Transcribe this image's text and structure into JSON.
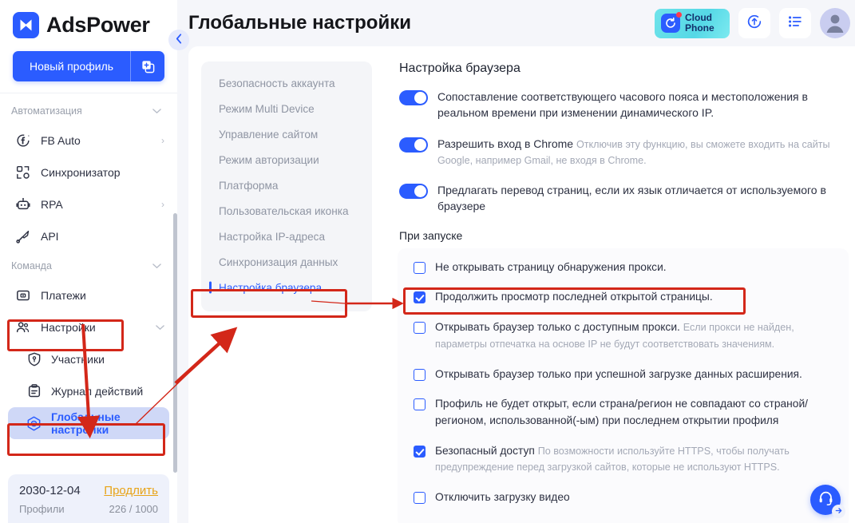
{
  "brand": {
    "name": "AdsPower",
    "logo_icon": "adspower-logo-icon"
  },
  "sidebar": {
    "new_profile_label": "Новый профиль",
    "new_profile_plus_icon": "add-profile-icon",
    "collapse_icon": "chevron-left-icon",
    "groups": [
      {
        "title": "Автоматизация",
        "collapse_icon": "chevron-down-icon",
        "items": [
          {
            "label": "FB Auto",
            "icon": "facebook-auto-icon",
            "chevron": "›"
          },
          {
            "label": "Синхронизатор",
            "icon": "synchronizer-icon",
            "chevron": ""
          },
          {
            "label": "RPA",
            "icon": "robot-icon",
            "chevron": "›"
          },
          {
            "label": "API",
            "icon": "api-icon",
            "chevron": ""
          }
        ]
      },
      {
        "title": "Команда",
        "collapse_icon": "chevron-down-icon",
        "items": [
          {
            "label": "Платежи",
            "icon": "payments-icon",
            "chevron": ""
          },
          {
            "label": "Настройки",
            "icon": "team-icon",
            "chevron": "⌄"
          }
        ],
        "sub_items": [
          {
            "label": "Участники",
            "icon": "shield-user-icon",
            "active": false
          },
          {
            "label": "Журнал действий",
            "icon": "clipboard-icon",
            "active": false
          },
          {
            "label": "Глобальные настройки",
            "icon": "gear-hex-icon",
            "active": true
          }
        ]
      }
    ],
    "footer": {
      "expire_date": "2030-12-04",
      "renew_label": "Продлить",
      "profiles_label": "Профили",
      "profiles_count": "226 / 1000"
    }
  },
  "topbar": {
    "title": "Глобальные настройки",
    "cloud_phone": {
      "line1": "Cloud",
      "line2": "Phone",
      "icon": "cloud-phone-icon",
      "badge": true
    },
    "sync_icon": "sync-upload-icon",
    "list_icon": "list-icon",
    "avatar_icon": "user-avatar-icon"
  },
  "settings_nav": {
    "items": [
      {
        "label": "Безопасность аккаунта",
        "active": false
      },
      {
        "label": "Режим Multi Device",
        "active": false
      },
      {
        "label": "Управление сайтом",
        "active": false
      },
      {
        "label": "Режим авторизации",
        "active": false
      },
      {
        "label": "Платформа",
        "active": false
      },
      {
        "label": "Пользовательская иконка",
        "active": false
      },
      {
        "label": "Настройка IP-адреса",
        "active": false
      },
      {
        "label": "Синхронизация данных",
        "active": false
      },
      {
        "label": "Настройка браузера",
        "active": true
      }
    ]
  },
  "pane": {
    "title": "Настройка браузера",
    "toggles": [
      {
        "on": true,
        "text": "Сопоставление соответствующего часового пояса и местоположения в реальном времени при изменении динамического IP.",
        "hint": ""
      },
      {
        "on": true,
        "text": "Разрешить вход в Chrome",
        "hint": "Отключив эту функцию, вы сможете входить на сайты Google, например Gmail, не входя в Chrome."
      },
      {
        "on": true,
        "text": "Предлагать перевод страниц, если их язык отличается от используемого в браузере",
        "hint": ""
      }
    ],
    "startup_label": "При запуске",
    "checkboxes": [
      {
        "checked": false,
        "text": "Не открывать страницу обнаружения прокси.",
        "hint": ""
      },
      {
        "checked": true,
        "text": "Продолжить просмотр последней открытой страницы.",
        "hint": ""
      },
      {
        "checked": false,
        "text": "Открывать браузер только с доступным прокси.",
        "hint": "Если прокси не найден, параметры отпечатка на основе IP не будут соответствовать значениям."
      },
      {
        "checked": false,
        "text": "Открывать браузер только при успешной загрузке данных расширения.",
        "hint": ""
      },
      {
        "checked": false,
        "text": "Профиль не будет открыт, если страна/регион не совпадают со страной/регионом, использованной(-ым) при последнем открытии профиля",
        "hint": ""
      },
      {
        "checked": true,
        "text": "Безопасный доступ",
        "hint": "По возможности используйте HTTPS, чтобы получать предупреждение перед загрузкой сайтов, которые не используют HTTPS."
      },
      {
        "checked": false,
        "text": "Отключить загрузку видео",
        "hint": ""
      }
    ]
  },
  "help": {
    "icon": "headset-icon",
    "arrow_icon": "arrow-right-icon"
  },
  "annotations": {
    "color": "#d32719"
  }
}
